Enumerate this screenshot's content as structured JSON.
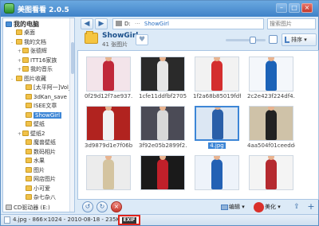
{
  "app": {
    "title": "美图看看 2.0.5"
  },
  "window_buttons": {
    "min": "–",
    "max": "□",
    "close": "×"
  },
  "tree": {
    "root": "我的电脑",
    "items": [
      {
        "label": "桌面",
        "exp": ""
      },
      {
        "label": "我的文档",
        "exp": "-"
      },
      {
        "label": "张德辉",
        "exp": "+"
      },
      {
        "label": "ITT16家族",
        "exp": "+"
      },
      {
        "label": "我的音乐",
        "exp": "+"
      },
      {
        "label": "图片收藏",
        "exp": "-"
      },
      {
        "label": "[太平阿一]Vol_01",
        "exp": ""
      },
      {
        "label": "3dKan_save",
        "exp": ""
      },
      {
        "label": "ISEE文章",
        "exp": ""
      },
      {
        "label": "ShowGirl",
        "exp": "",
        "selected": true
      },
      {
        "label": "壁纸",
        "exp": ""
      },
      {
        "label": "壁纸2",
        "exp": "+"
      },
      {
        "label": "魔兽壁纸",
        "exp": ""
      },
      {
        "label": "数码相片",
        "exp": ""
      },
      {
        "label": "水果",
        "exp": ""
      },
      {
        "label": "图片",
        "exp": ""
      },
      {
        "label": "网店图片",
        "exp": ""
      },
      {
        "label": "小可爱",
        "exp": ""
      },
      {
        "label": "杂七杂八",
        "exp": ""
      }
    ],
    "bottom_drive": "CD驱动器 (E:)"
  },
  "toolbar": {
    "back": "◀",
    "forward": "▶",
    "address_drive": "D:",
    "address_sep": "···",
    "address_current": "ShowGirl",
    "search_placeholder": "搜索图片",
    "folder_name": "ShowGirl",
    "folder_count": "41 张图片",
    "heart": "♥",
    "sort_label": "排序 ▾"
  },
  "thumbnails": [
    {
      "name": "0f29d12f7ae937...",
      "bg": "#f3e4ea",
      "fig": "#c0283a"
    },
    {
      "name": "1cfe11ddfbf2705...",
      "bg": "#2a2a2a",
      "fig": "#e6e6e6"
    },
    {
      "name": "1f2a68b85019fdf...",
      "bg": "#f2f2f2",
      "fig": "#d42e2e"
    },
    {
      "name": "2c2e423f224df4...",
      "bg": "#f4f7fb",
      "fig": "#1c63b8"
    },
    {
      "name": "3d9879d1e7f06b...",
      "bg": "#b1231f",
      "fig": "#f1f1f1"
    },
    {
      "name": "3f92e05b2899f2...",
      "bg": "#4b4b56",
      "fig": "#d8d8d8"
    },
    {
      "name": "4.jpg",
      "bg": "#dce7f3",
      "fig": "#2a5fa8",
      "selected": true
    },
    {
      "name": "4aa504f01ceeddc...",
      "bg": "#cfc2a8",
      "fig": "#222222"
    },
    {
      "name": "",
      "bg": "#ececec",
      "fig": "#d4c4a0"
    },
    {
      "name": "",
      "bg": "#1a1a1a",
      "fig": "#c0202a"
    },
    {
      "name": "",
      "bg": "#eef3fa",
      "fig": "#2361b4"
    },
    {
      "name": "",
      "bg": "#f4f4f4",
      "fig": "#b52a30"
    }
  ],
  "bottom": {
    "rotate_left": "↺",
    "rotate_right": "↻",
    "delete": "×",
    "edit_label": "编辑 ▾",
    "beautify_label": "美化 ▾",
    "share": "⇪",
    "add": "+"
  },
  "status": {
    "text": "4.jpg - 866×1024 - 2010-08-18 - 235KB",
    "exif": "EXIF"
  }
}
